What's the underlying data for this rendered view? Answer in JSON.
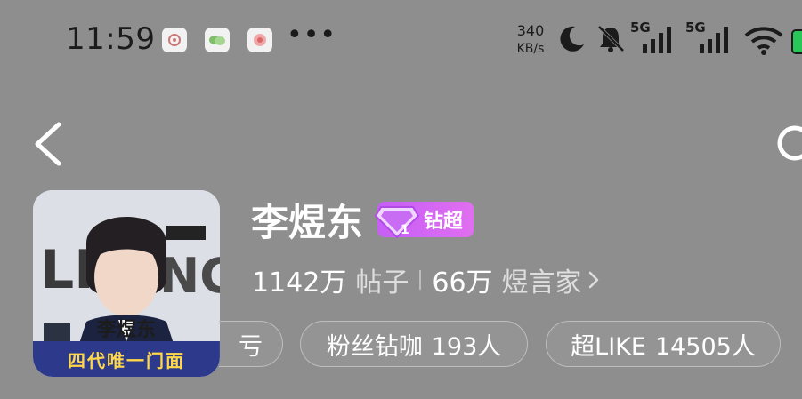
{
  "status_bar": {
    "time": "11:59",
    "net_speed_value": "340",
    "net_speed_unit": "KB/s",
    "signal_1_label": "5G",
    "signal_2_label": "5G",
    "icons": [
      "notification-app-1-icon",
      "notification-app-2-icon",
      "notification-app-3-icon",
      "more-dots",
      "moon-icon",
      "mute-bell-icon",
      "signal-5g-icon",
      "signal-5g-icon",
      "wifi-icon",
      "battery-icon"
    ],
    "more_dots": "•••"
  },
  "nav": {
    "back_icon": "chevron-left-icon",
    "right_icon": "circle-icon"
  },
  "profile": {
    "name": "李煜东",
    "badge_label": "钻超",
    "badge_level": "1",
    "avatar_caption": "李煜东",
    "avatar_banner": "四代唯一门面",
    "posts_count": "1142万",
    "posts_label": "帖子",
    "fans_count": "66万",
    "fans_label": "煜言家"
  },
  "chips": {
    "partial_label": "亏",
    "chip1_label": "粉丝钻咖",
    "chip1_value": "193人",
    "chip2_label": "超LIKE",
    "chip2_value": "14505人"
  },
  "colors": {
    "background": "#8e8e8e",
    "badge_start": "#c65ff6",
    "badge_end": "#e06ef0",
    "battery": "#29c65a"
  }
}
